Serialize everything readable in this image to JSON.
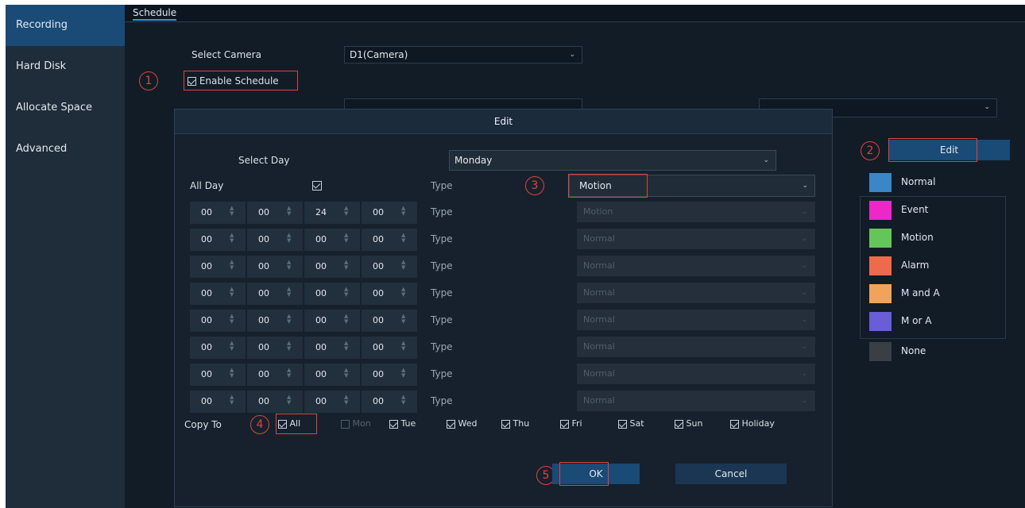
{
  "sidebar": {
    "items": [
      {
        "label": "Recording",
        "active": true
      },
      {
        "label": "Hard Disk",
        "active": false
      },
      {
        "label": "Allocate Space",
        "active": false
      },
      {
        "label": "Advanced",
        "active": false
      }
    ]
  },
  "tabs": [
    {
      "label": "Schedule"
    }
  ],
  "form": {
    "select_camera_label": "Select Camera",
    "camera_value": "D1(Camera)",
    "enable_schedule_label": "Enable Schedule",
    "enable_schedule_checked": true
  },
  "markers": [
    "1",
    "2",
    "3",
    "4",
    "5"
  ],
  "dialog": {
    "title": "Edit",
    "select_day_label": "Select Day",
    "day_value": "Monday",
    "all_day_label": "All Day",
    "all_day_checked": true,
    "type_label": "Type",
    "type_value": "Motion",
    "time_rows": [
      {
        "start_h": "00",
        "start_m": "00",
        "end_h": "24",
        "end_m": "00",
        "type": "Motion"
      },
      {
        "start_h": "00",
        "start_m": "00",
        "end_h": "00",
        "end_m": "00",
        "type": "Normal"
      },
      {
        "start_h": "00",
        "start_m": "00",
        "end_h": "00",
        "end_m": "00",
        "type": "Normal"
      },
      {
        "start_h": "00",
        "start_m": "00",
        "end_h": "00",
        "end_m": "00",
        "type": "Normal"
      },
      {
        "start_h": "00",
        "start_m": "00",
        "end_h": "00",
        "end_m": "00",
        "type": "Normal"
      },
      {
        "start_h": "00",
        "start_m": "00",
        "end_h": "00",
        "end_m": "00",
        "type": "Normal"
      },
      {
        "start_h": "00",
        "start_m": "00",
        "end_h": "00",
        "end_m": "00",
        "type": "Normal"
      },
      {
        "start_h": "00",
        "start_m": "00",
        "end_h": "00",
        "end_m": "00",
        "type": "Normal"
      }
    ],
    "copy_to_label": "Copy To",
    "copy_to": [
      {
        "label": "All",
        "checked": true
      },
      {
        "label": "Mon",
        "checked": false
      },
      {
        "label": "Tue",
        "checked": true
      },
      {
        "label": "Wed",
        "checked": true
      },
      {
        "label": "Thu",
        "checked": true
      },
      {
        "label": "Fri",
        "checked": true
      },
      {
        "label": "Sat",
        "checked": true
      },
      {
        "label": "Sun",
        "checked": true
      },
      {
        "label": "Holiday",
        "checked": true
      }
    ],
    "ok_label": "OK",
    "cancel_label": "Cancel"
  },
  "edit_button_label": "Edit",
  "legend": [
    {
      "label": "Normal",
      "color": "#3a86c6"
    },
    {
      "label": "Event",
      "color": "#ee27c8"
    },
    {
      "label": "Motion",
      "color": "#64c65a"
    },
    {
      "label": "Alarm",
      "color": "#ee6a4c"
    },
    {
      "label": "M and A",
      "color": "#f0a35a"
    },
    {
      "label": "M or A",
      "color": "#6a5dd8"
    },
    {
      "label": "None",
      "color": "#3a3f44"
    }
  ],
  "colors": {
    "accent": "#1a4a76",
    "highlight": "#e0443b"
  }
}
